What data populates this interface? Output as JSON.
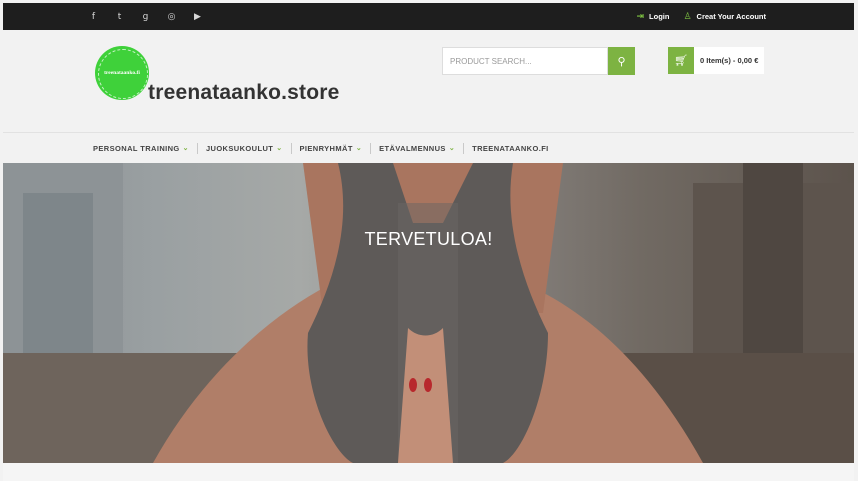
{
  "topbar": {
    "social_icons": [
      "facebook-icon",
      "twitter-icon",
      "google-plus-icon",
      "instagram-icon",
      "youtube-icon"
    ],
    "social_glyphs": [
      "f",
      "t",
      "g",
      "◎",
      "▶"
    ],
    "login_label": "Login",
    "create_account_label": "Creat Your Account"
  },
  "header": {
    "logo_text": "treenataanko.fi",
    "site_title": "treenataanko.store",
    "search_placeholder": "PRODUCT SEARCH...",
    "cart_label": "0 Item(s) - 0,00 €"
  },
  "nav": {
    "items": [
      {
        "label": "PERSONAL TRAINING",
        "has_dropdown": true
      },
      {
        "label": "JUOKSUKOULUT",
        "has_dropdown": true
      },
      {
        "label": "PIENRYHMÄT",
        "has_dropdown": true
      },
      {
        "label": "ETÄVALMENNUS",
        "has_dropdown": true
      },
      {
        "label": "TREENATAANKO.FI",
        "has_dropdown": false
      }
    ]
  },
  "hero": {
    "title": "TERVETULOA!"
  },
  "colors": {
    "accent": "#7db342",
    "topbar_bg": "#1e1e1e",
    "logo_green": "#3fd13a"
  }
}
